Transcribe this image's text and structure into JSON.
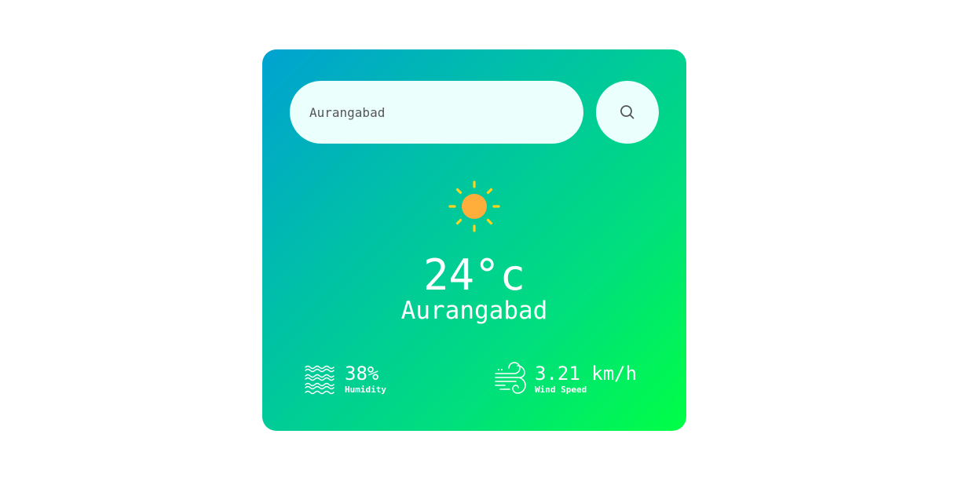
{
  "search": {
    "value": "Aurangabad"
  },
  "weather": {
    "icon": "sun-icon",
    "temperature": "24°c",
    "city": "Aurangabad"
  },
  "details": {
    "humidity": {
      "value": "38%",
      "label": "Humidity",
      "icon": "humidity-waves-icon"
    },
    "wind": {
      "value": "3.21 km/h",
      "label": "Wind Speed",
      "icon": "wind-icon"
    }
  },
  "colors": {
    "gradient_start": "#00a2d1",
    "gradient_end": "#00ff45",
    "input_bg": "#ebfffc",
    "sun_core": "#ffad3b",
    "sun_rays": "#ffd21f"
  }
}
